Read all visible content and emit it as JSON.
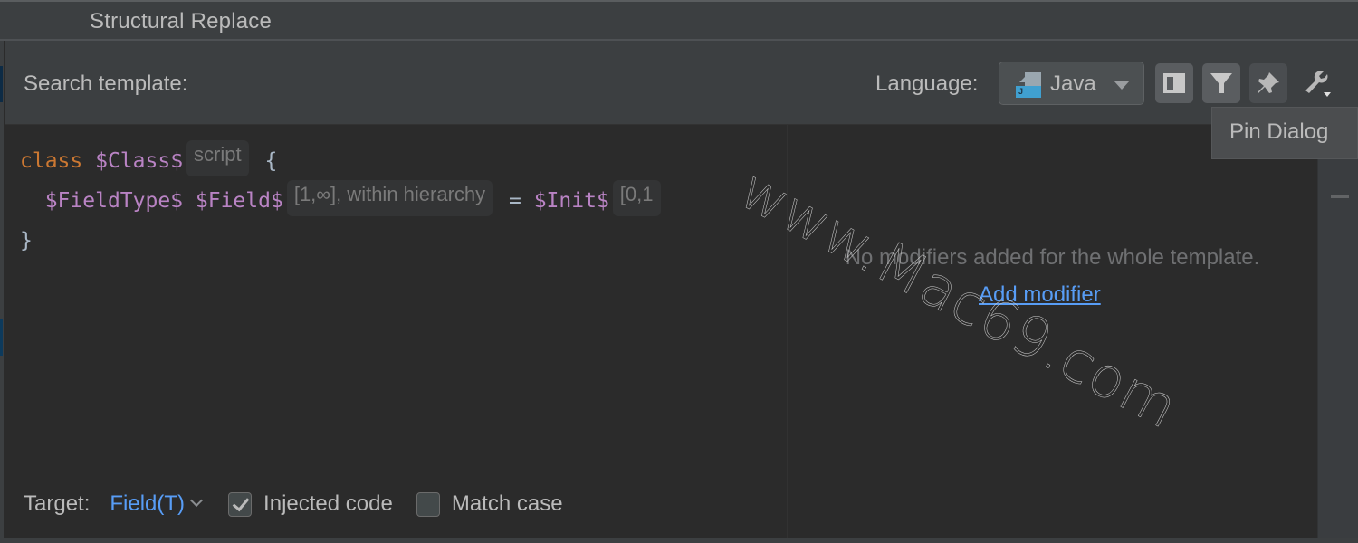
{
  "window": {
    "title": "Structural Replace"
  },
  "header": {
    "search_label": "Search template:",
    "language_label": "Language:",
    "language_value": "Java",
    "language_icon": "java-file-icon",
    "toolbar": [
      {
        "icon": "toggle-panel-icon",
        "tooltip": ""
      },
      {
        "icon": "filter-icon",
        "tooltip": ""
      },
      {
        "icon": "pin-icon",
        "tooltip": "Pin Dialog"
      },
      {
        "icon": "wrench-dropdown-icon",
        "tooltip": ""
      }
    ]
  },
  "tooltip": {
    "text": "Pin Dialog"
  },
  "editor": {
    "lines": [
      {
        "tokens": [
          {
            "t": "class",
            "k": "kw"
          },
          {
            "t": " ",
            "k": "punc"
          },
          {
            "t": "$Class$",
            "k": "var"
          },
          {
            "t": "script",
            "k": "inlay"
          },
          {
            "t": " {",
            "k": "punc"
          }
        ]
      },
      {
        "tokens": [
          {
            "t": "  ",
            "k": "punc"
          },
          {
            "t": "$FieldType$",
            "k": "var"
          },
          {
            "t": " ",
            "k": "punc"
          },
          {
            "t": "$Field$",
            "k": "var"
          },
          {
            "t": "[1,∞], within hierarchy",
            "k": "inlay"
          },
          {
            "t": " = ",
            "k": "punc"
          },
          {
            "t": "$Init$",
            "k": "var"
          },
          {
            "t": "[0,1",
            "k": "inlay"
          }
        ]
      },
      {
        "tokens": [
          {
            "t": "}",
            "k": "punc"
          }
        ]
      }
    ]
  },
  "options": {
    "target_label": "Target:",
    "target_value": "Field(T)",
    "injected_code_label": "Injected code",
    "injected_code_checked": true,
    "match_case_label": "Match case",
    "match_case_checked": false
  },
  "modifiers": {
    "empty_text": "No modifiers added for the whole template.",
    "add_link": "Add modifier"
  },
  "watermark": {
    "text": "www.Mac69.com"
  },
  "colors": {
    "keyword": "#cc7832",
    "variable": "#b983c4",
    "link": "#589df6",
    "editor_bg": "#2b2b2b",
    "panel_bg": "#3c3f41"
  }
}
